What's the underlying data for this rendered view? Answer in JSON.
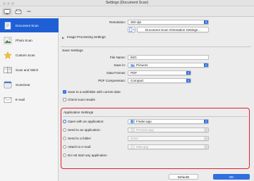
{
  "window": {
    "title": "Settings (Document Scan)"
  },
  "toolbar": {
    "more_label": "•••"
  },
  "sidebar": {
    "items": [
      {
        "label": "Document Scan",
        "icon": "document-scan-icon",
        "selected": true
      },
      {
        "label": "Photo Scan",
        "icon": "photo-scan-icon",
        "selected": false
      },
      {
        "label": "Custom Scan",
        "icon": "custom-scan-icon",
        "selected": false
      },
      {
        "label": "Scan and Stitch",
        "icon": "scan-stitch-icon",
        "selected": false
      },
      {
        "label": "ScanGear",
        "icon": "scangear-icon",
        "selected": false
      },
      {
        "label": "E-mail",
        "icon": "email-icon",
        "selected": false
      }
    ]
  },
  "scan_options": {
    "resolution_label": "Resolution:",
    "resolution_value": "300 dpi",
    "orientation_button": "Document Scan Orientation Settings...",
    "image_processing_label": "Image Processing Settings"
  },
  "save_settings": {
    "title": "Save Settings",
    "file_name_label": "File Name:",
    "file_name_value": "IMG",
    "save_in_label": "Save in:",
    "save_in_value": "Pictures",
    "data_format_label": "Data Format:",
    "data_format_value": "PDF",
    "pdf_compression_label": "PDF Compression:",
    "pdf_compression_value": "Compact",
    "subfolder_label": "Save to a subfolder with current date",
    "subfolder_checked": true,
    "check_results_label": "Check scan results",
    "check_results_checked": false
  },
  "app_settings": {
    "title": "Application Settings",
    "open_app_label": "Open with an application:",
    "open_app_value": "Finder.app",
    "send_app_label": "Send to an application:",
    "send_app_value": "Preview.app",
    "send_folder_label": "Send to a folder:",
    "send_folder_value": "None",
    "email_label": "Attach to e-mail:",
    "email_value": "Mail.app",
    "no_app_label": "Do not start any application"
  },
  "footer": {
    "defaults_label": "Defaults",
    "ok_label": "OK"
  },
  "colors": {
    "accent": "#2f6fe0",
    "selection": "#1f5fd6",
    "highlight_border": "#e0202a"
  }
}
